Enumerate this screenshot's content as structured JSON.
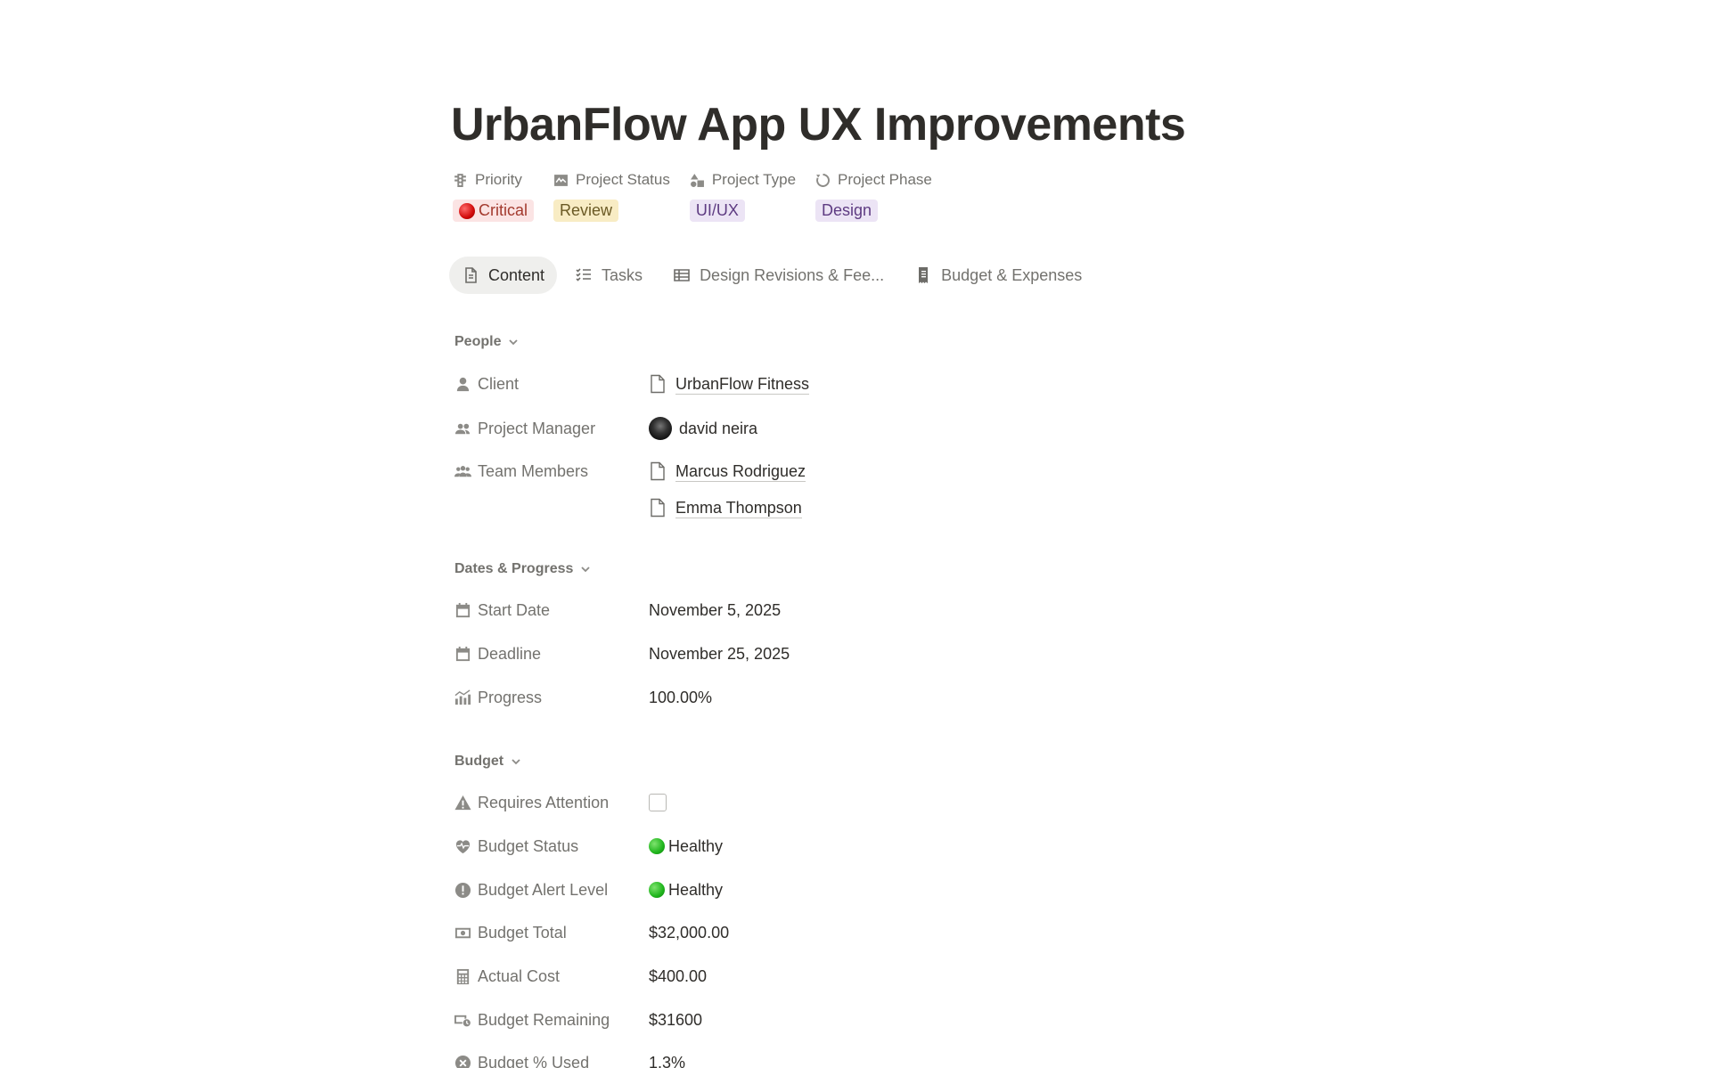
{
  "page": {
    "title": "UrbanFlow App UX Improvements"
  },
  "header_props": [
    {
      "name": "Priority",
      "icon": "traffic-light-icon",
      "value": "Critical",
      "color": "red",
      "has_dot": true
    },
    {
      "name": "Project Status",
      "icon": "activity-icon",
      "value": "Review",
      "color": "yellow",
      "has_dot": false
    },
    {
      "name": "Project Type",
      "icon": "shapes-icon",
      "value": "UI/UX",
      "color": "purple",
      "has_dot": false
    },
    {
      "name": "Project Phase",
      "icon": "cycle-icon",
      "value": "Design",
      "color": "purple",
      "has_dot": false
    }
  ],
  "tabs": [
    {
      "label": "Content",
      "icon": "document-icon",
      "active": true
    },
    {
      "label": "Tasks",
      "icon": "checklist-icon",
      "active": false
    },
    {
      "label": "Design Revisions & Fee...",
      "icon": "table-icon",
      "active": false
    },
    {
      "label": "Budget & Expenses",
      "icon": "receipt-icon",
      "active": false
    }
  ],
  "sections": {
    "people": {
      "title": "People",
      "client_label": "Client",
      "client_value": "UrbanFlow Fitness",
      "pm_label": "Project Manager",
      "pm_value": "david neira",
      "team_label": "Team Members",
      "team_values": [
        "Marcus Rodriguez",
        "Emma Thompson"
      ]
    },
    "dates": {
      "title": "Dates & Progress",
      "start_label": "Start Date",
      "start_value": "November 5, 2025",
      "deadline_label": "Deadline",
      "deadline_value": "November 25, 2025",
      "progress_label": "Progress",
      "progress_value": "100.00%"
    },
    "budget": {
      "title": "Budget",
      "attention_label": "Requires Attention",
      "attention_checked": false,
      "status_label": "Budget Status",
      "status_value": "Healthy",
      "alert_label": "Budget Alert Level",
      "alert_value": "Healthy",
      "total_label": "Budget Total",
      "total_value": "$32,000.00",
      "actual_label": "Actual Cost",
      "actual_value": "$400.00",
      "remaining_label": "Budget Remaining",
      "remaining_value": "$31600",
      "used_label": "Budget % Used",
      "used_value": "1.3%"
    }
  }
}
